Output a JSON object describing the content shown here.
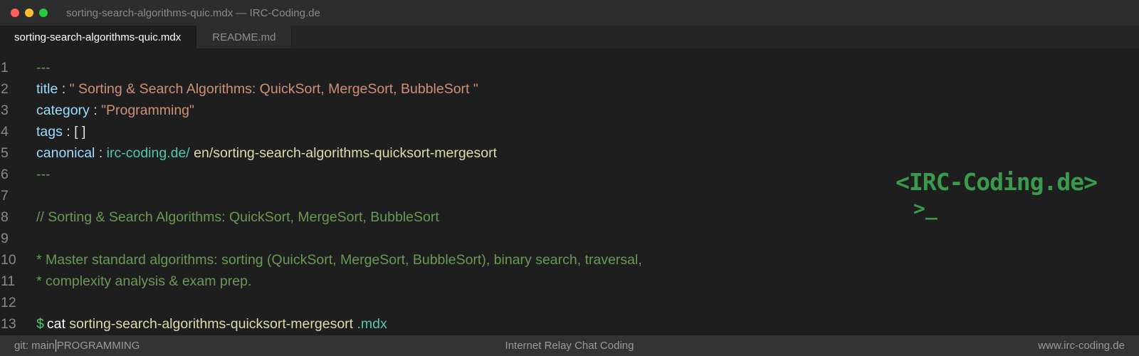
{
  "window": {
    "title": "sorting-search-algorithms-quic.mdx — IRC-Coding.de"
  },
  "tabs": [
    {
      "label": "sorting-search-algorithms-quic.mdx",
      "active": true
    },
    {
      "label": "README.md",
      "active": false
    }
  ],
  "editor": {
    "lines": {
      "l1": {
        "num": "1",
        "dash": "---"
      },
      "l2": {
        "num": "2",
        "key": "title",
        "sep": " : ",
        "value": "\" Sorting & Search Algorithms: QuickSort, MergeSort, BubbleSort \""
      },
      "l3": {
        "num": "3",
        "key": "category",
        "sep": " : ",
        "value": "\"Programming\""
      },
      "l4": {
        "num": "4",
        "key": "tags",
        "sep": " : ",
        "value": "[ ]"
      },
      "l5": {
        "num": "5",
        "key": "canonical",
        "sep": " : ",
        "url": "irc-coding.de/",
        "path": " en/sorting-search-algorithms-quicksort-mergesort"
      },
      "l6": {
        "num": "6",
        "dash": "---"
      },
      "l7": {
        "num": "7"
      },
      "l8": {
        "num": "8",
        "comment": "// Sorting & Search Algorithms: QuickSort, MergeSort, BubbleSort"
      },
      "l9": {
        "num": "9"
      },
      "l10": {
        "num": "10",
        "comment": "* Master standard algorithms: sorting (QuickSort, MergeSort, BubbleSort), binary search, traversal,"
      },
      "l11": {
        "num": "11",
        "comment": "* complexity analysis & exam prep."
      },
      "l12": {
        "num": "12"
      },
      "l13": {
        "num": "13",
        "prompt": "$",
        "cmd": "cat",
        "file": " sorting-search-algorithms-quicksort-mergesort",
        "ext": " .mdx"
      }
    }
  },
  "logo": {
    "text": "<IRC-Coding.de>",
    "prompt": ">_"
  },
  "status": {
    "branch": "git: main",
    "category": "PROGRAMMING",
    "center": "Internet Relay Chat Coding",
    "right": "www.irc-coding.de"
  },
  "colors": {
    "background": "#1e1e1e",
    "accent_green": "#3a9a4e",
    "key": "#9cdcfe",
    "string": "#ce9178",
    "comment": "#6a9955"
  }
}
